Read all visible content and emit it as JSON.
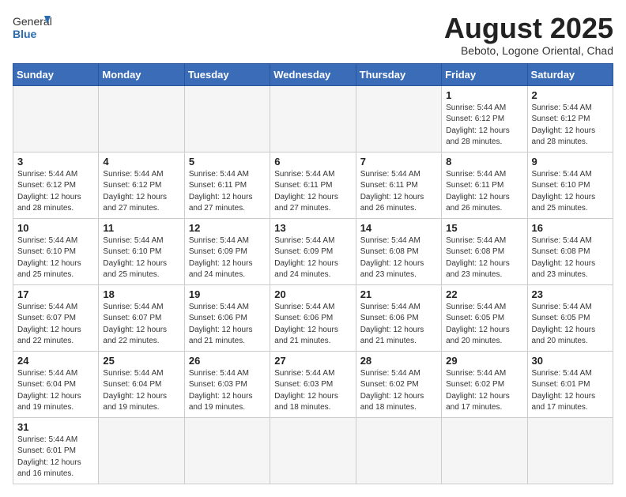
{
  "logo": {
    "text_general": "General",
    "text_blue": "Blue"
  },
  "title": "August 2025",
  "subtitle": "Beboto, Logone Oriental, Chad",
  "weekdays": [
    "Sunday",
    "Monday",
    "Tuesday",
    "Wednesday",
    "Thursday",
    "Friday",
    "Saturday"
  ],
  "weeks": [
    [
      {
        "day": "",
        "info": ""
      },
      {
        "day": "",
        "info": ""
      },
      {
        "day": "",
        "info": ""
      },
      {
        "day": "",
        "info": ""
      },
      {
        "day": "",
        "info": ""
      },
      {
        "day": "1",
        "info": "Sunrise: 5:44 AM\nSunset: 6:12 PM\nDaylight: 12 hours\nand 28 minutes."
      },
      {
        "day": "2",
        "info": "Sunrise: 5:44 AM\nSunset: 6:12 PM\nDaylight: 12 hours\nand 28 minutes."
      }
    ],
    [
      {
        "day": "3",
        "info": "Sunrise: 5:44 AM\nSunset: 6:12 PM\nDaylight: 12 hours\nand 28 minutes."
      },
      {
        "day": "4",
        "info": "Sunrise: 5:44 AM\nSunset: 6:12 PM\nDaylight: 12 hours\nand 27 minutes."
      },
      {
        "day": "5",
        "info": "Sunrise: 5:44 AM\nSunset: 6:11 PM\nDaylight: 12 hours\nand 27 minutes."
      },
      {
        "day": "6",
        "info": "Sunrise: 5:44 AM\nSunset: 6:11 PM\nDaylight: 12 hours\nand 27 minutes."
      },
      {
        "day": "7",
        "info": "Sunrise: 5:44 AM\nSunset: 6:11 PM\nDaylight: 12 hours\nand 26 minutes."
      },
      {
        "day": "8",
        "info": "Sunrise: 5:44 AM\nSunset: 6:11 PM\nDaylight: 12 hours\nand 26 minutes."
      },
      {
        "day": "9",
        "info": "Sunrise: 5:44 AM\nSunset: 6:10 PM\nDaylight: 12 hours\nand 25 minutes."
      }
    ],
    [
      {
        "day": "10",
        "info": "Sunrise: 5:44 AM\nSunset: 6:10 PM\nDaylight: 12 hours\nand 25 minutes."
      },
      {
        "day": "11",
        "info": "Sunrise: 5:44 AM\nSunset: 6:10 PM\nDaylight: 12 hours\nand 25 minutes."
      },
      {
        "day": "12",
        "info": "Sunrise: 5:44 AM\nSunset: 6:09 PM\nDaylight: 12 hours\nand 24 minutes."
      },
      {
        "day": "13",
        "info": "Sunrise: 5:44 AM\nSunset: 6:09 PM\nDaylight: 12 hours\nand 24 minutes."
      },
      {
        "day": "14",
        "info": "Sunrise: 5:44 AM\nSunset: 6:08 PM\nDaylight: 12 hours\nand 23 minutes."
      },
      {
        "day": "15",
        "info": "Sunrise: 5:44 AM\nSunset: 6:08 PM\nDaylight: 12 hours\nand 23 minutes."
      },
      {
        "day": "16",
        "info": "Sunrise: 5:44 AM\nSunset: 6:08 PM\nDaylight: 12 hours\nand 23 minutes."
      }
    ],
    [
      {
        "day": "17",
        "info": "Sunrise: 5:44 AM\nSunset: 6:07 PM\nDaylight: 12 hours\nand 22 minutes."
      },
      {
        "day": "18",
        "info": "Sunrise: 5:44 AM\nSunset: 6:07 PM\nDaylight: 12 hours\nand 22 minutes."
      },
      {
        "day": "19",
        "info": "Sunrise: 5:44 AM\nSunset: 6:06 PM\nDaylight: 12 hours\nand 21 minutes."
      },
      {
        "day": "20",
        "info": "Sunrise: 5:44 AM\nSunset: 6:06 PM\nDaylight: 12 hours\nand 21 minutes."
      },
      {
        "day": "21",
        "info": "Sunrise: 5:44 AM\nSunset: 6:06 PM\nDaylight: 12 hours\nand 21 minutes."
      },
      {
        "day": "22",
        "info": "Sunrise: 5:44 AM\nSunset: 6:05 PM\nDaylight: 12 hours\nand 20 minutes."
      },
      {
        "day": "23",
        "info": "Sunrise: 5:44 AM\nSunset: 6:05 PM\nDaylight: 12 hours\nand 20 minutes."
      }
    ],
    [
      {
        "day": "24",
        "info": "Sunrise: 5:44 AM\nSunset: 6:04 PM\nDaylight: 12 hours\nand 19 minutes."
      },
      {
        "day": "25",
        "info": "Sunrise: 5:44 AM\nSunset: 6:04 PM\nDaylight: 12 hours\nand 19 minutes."
      },
      {
        "day": "26",
        "info": "Sunrise: 5:44 AM\nSunset: 6:03 PM\nDaylight: 12 hours\nand 19 minutes."
      },
      {
        "day": "27",
        "info": "Sunrise: 5:44 AM\nSunset: 6:03 PM\nDaylight: 12 hours\nand 18 minutes."
      },
      {
        "day": "28",
        "info": "Sunrise: 5:44 AM\nSunset: 6:02 PM\nDaylight: 12 hours\nand 18 minutes."
      },
      {
        "day": "29",
        "info": "Sunrise: 5:44 AM\nSunset: 6:02 PM\nDaylight: 12 hours\nand 17 minutes."
      },
      {
        "day": "30",
        "info": "Sunrise: 5:44 AM\nSunset: 6:01 PM\nDaylight: 12 hours\nand 17 minutes."
      }
    ],
    [
      {
        "day": "31",
        "info": "Sunrise: 5:44 AM\nSunset: 6:01 PM\nDaylight: 12 hours\nand 16 minutes."
      },
      {
        "day": "",
        "info": ""
      },
      {
        "day": "",
        "info": ""
      },
      {
        "day": "",
        "info": ""
      },
      {
        "day": "",
        "info": ""
      },
      {
        "day": "",
        "info": ""
      },
      {
        "day": "",
        "info": ""
      }
    ]
  ]
}
